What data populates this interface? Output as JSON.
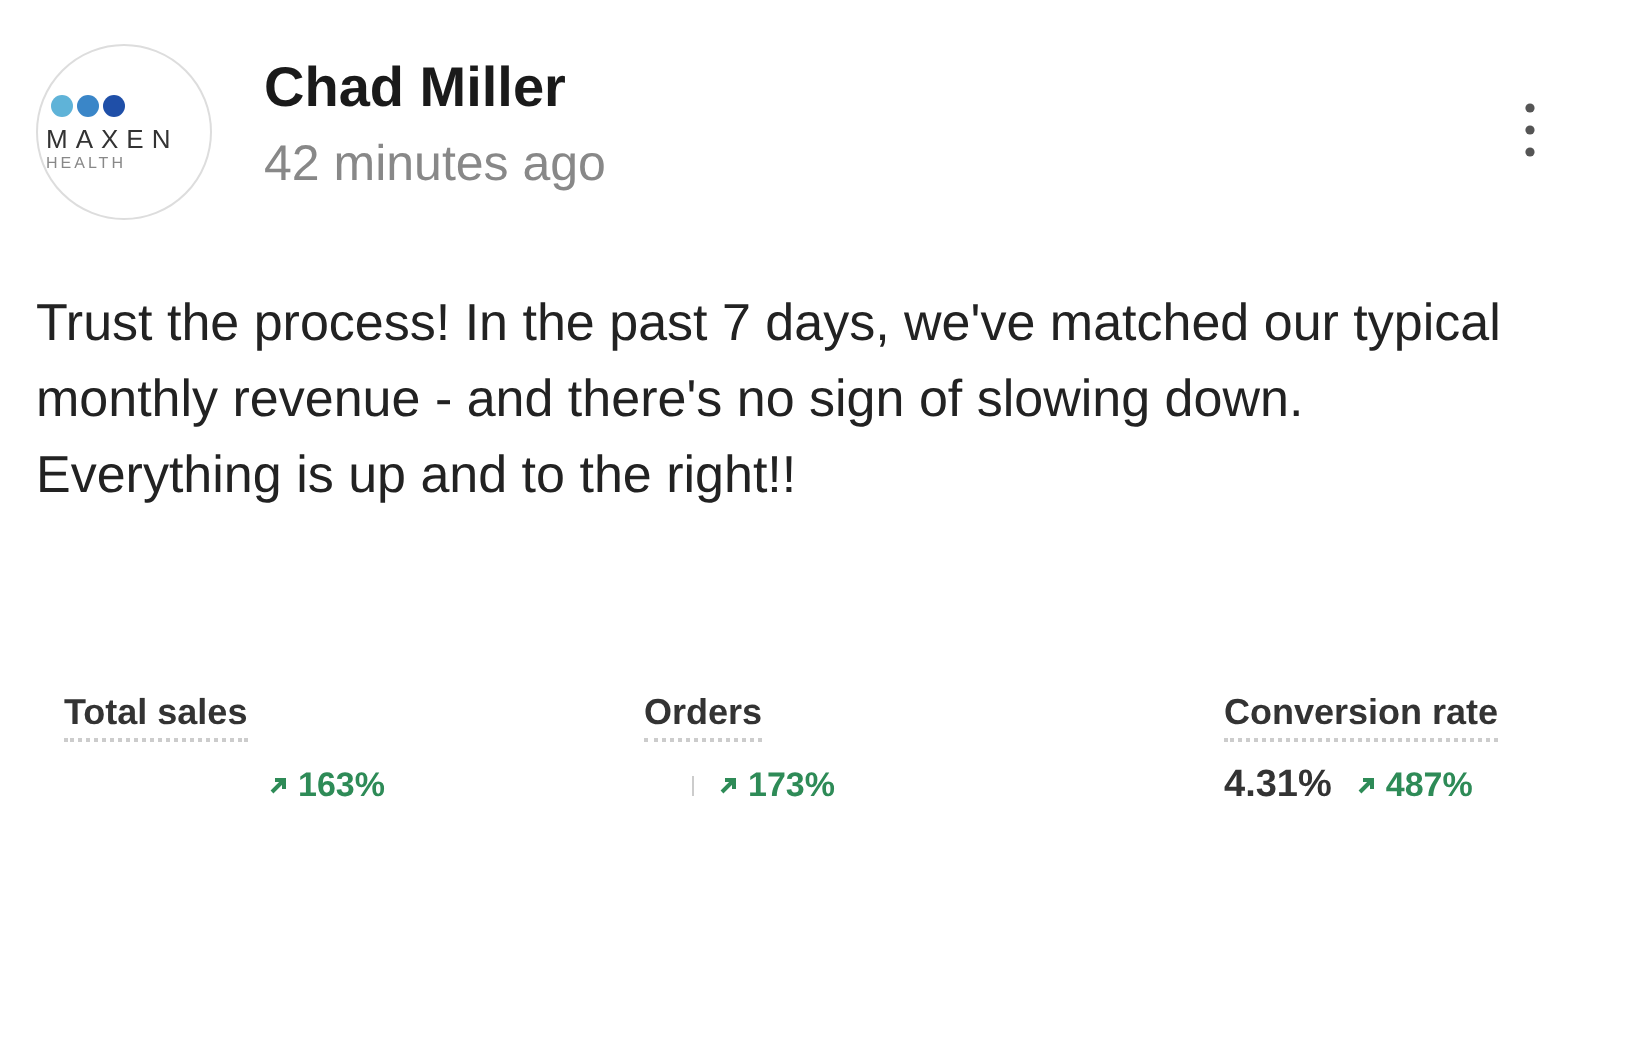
{
  "post": {
    "logo": {
      "wordmark": "MAXEN",
      "subtitle": "HEALTH"
    },
    "author": "Chad Miller",
    "time": "42 minutes ago",
    "body": "Trust the process! In the past 7 days, we've matched our typical monthly revenue - and there's no sign of slowing down. Everything is up and to the right!!"
  },
  "metrics": [
    {
      "label": "Total sales",
      "change": "163%",
      "kind": "blank"
    },
    {
      "label": "Orders",
      "change": "173%",
      "kind": "mark"
    },
    {
      "label": "Conversion rate",
      "value": "4.31%",
      "change": "487%",
      "kind": "value"
    }
  ]
}
